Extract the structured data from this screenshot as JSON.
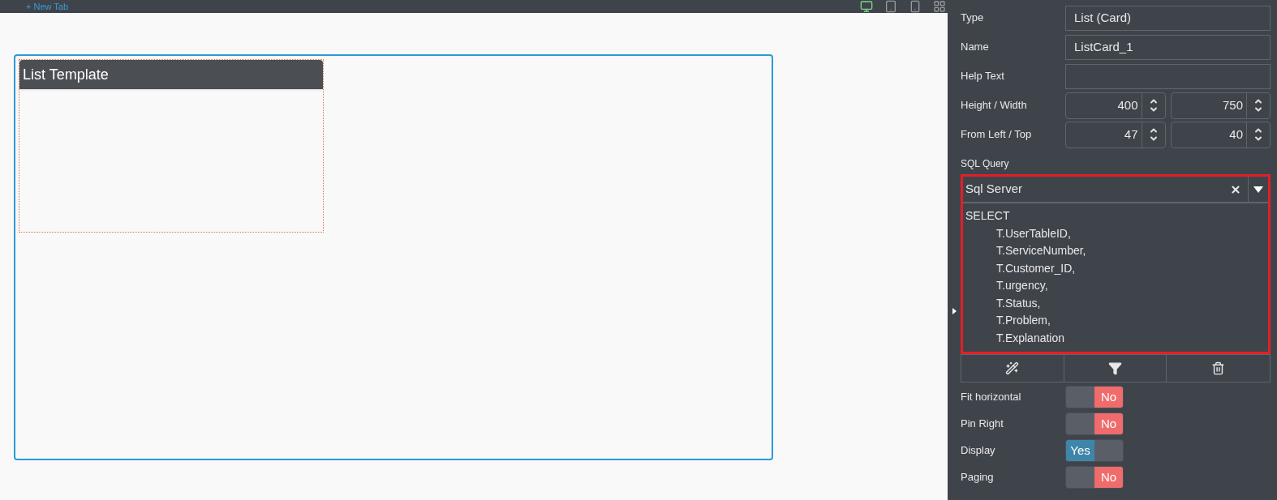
{
  "top_bar": {
    "new_tab": "+ New Tab",
    "devices": [
      {
        "kind": "desktop",
        "selected": true
      },
      {
        "kind": "tablet",
        "selected": false
      },
      {
        "kind": "phone",
        "selected": false
      },
      {
        "kind": "grid",
        "selected": false
      }
    ]
  },
  "canvas": {
    "card": {
      "title": "List Template"
    }
  },
  "properties": {
    "fields": [
      {
        "kind": "text",
        "label": "Type",
        "value": "List (Card)"
      },
      {
        "kind": "text",
        "label": "Name",
        "value": "ListCard_1"
      },
      {
        "kind": "text",
        "label": "Help Text"
      },
      {
        "kind": "pair",
        "label": "Height / Width",
        "values": [
          "400",
          "750"
        ]
      },
      {
        "kind": "pair",
        "label": "From Left / Top",
        "values": [
          "47",
          "40"
        ]
      }
    ],
    "sql": {
      "label": "SQL Query",
      "dialect": "Sql Server",
      "keyword": "SELECT",
      "columns": [
        "T.UserTableID,",
        "T.ServiceNumber,",
        "T.Customer_ID,",
        "T.urgency,",
        "T.Status,",
        "T.Problem,",
        "T.Explanation"
      ]
    },
    "toggles": [
      {
        "label": "Fit horizontal",
        "on": false,
        "text": "No"
      },
      {
        "label": "Pin Right",
        "on": false,
        "text": "No"
      },
      {
        "label": "Display",
        "on": true,
        "text": "Yes"
      },
      {
        "label": "Paging",
        "on": false,
        "text": "No"
      }
    ]
  }
}
